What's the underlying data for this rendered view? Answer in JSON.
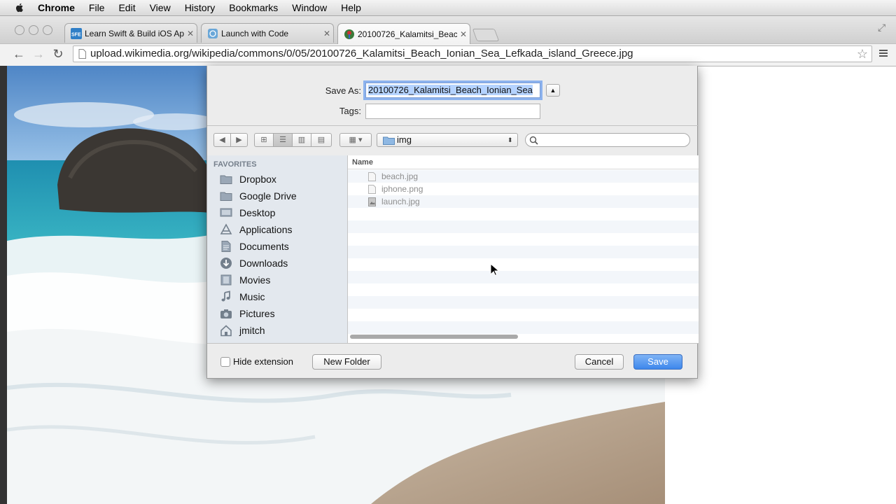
{
  "menubar": {
    "app_name": "Chrome",
    "items": [
      "File",
      "Edit",
      "View",
      "History",
      "Bookmarks",
      "Window",
      "Help"
    ]
  },
  "tabs": [
    {
      "title": "Learn Swift & Build iOS Ap",
      "favicon": "sfe-icon",
      "active": false
    },
    {
      "title": "Launch with Code",
      "favicon": "globe-icon",
      "active": false
    },
    {
      "title": "20100726_Kalamitsi_Beac",
      "favicon": "wikimedia-icon",
      "active": true
    }
  ],
  "toolbar": {
    "url": "upload.wikimedia.org/wikipedia/commons/0/05/20100726_Kalamitsi_Beach_Ionian_Sea_Lefkada_island_Greece.jpg"
  },
  "dialog": {
    "save_as_label": "Save As:",
    "save_as_value": "20100726_Kalamitsi_Beach_Ionian_Sea",
    "tags_label": "Tags:",
    "tags_value": "",
    "current_folder": "img",
    "search_placeholder": "",
    "sidebar": {
      "header": "FAVORITES",
      "items": [
        "Dropbox",
        "Google Drive",
        "Desktop",
        "Applications",
        "Documents",
        "Downloads",
        "Movies",
        "Music",
        "Pictures",
        "jmitch"
      ]
    },
    "file_list": {
      "column_name": "Name",
      "files": [
        "beach.jpg",
        "iphone.png",
        "launch.jpg"
      ]
    },
    "hide_extension_label": "Hide extension",
    "hide_extension_checked": false,
    "new_folder_label": "New Folder",
    "cancel_label": "Cancel",
    "save_label": "Save"
  },
  "colors": {
    "accent": "#3d87ec",
    "selection": "#b5d3ff",
    "sidebar_bg": "#e3e8ee"
  }
}
